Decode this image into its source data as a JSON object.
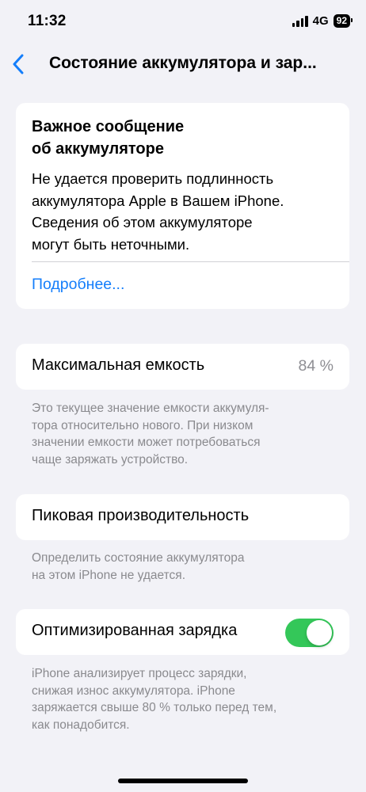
{
  "status_bar": {
    "time": "11:32",
    "network": "4G",
    "battery_level": "92",
    "icons": [
      "signal-icon",
      "battery-icon"
    ]
  },
  "nav": {
    "title": "Состояние аккумулятора и зар...",
    "back_icon": "chevron-left-icon"
  },
  "alert": {
    "title": "Важное сообщение\nоб аккумуляторе",
    "body": "Не удается проверить подлинность\nаккумулятора Apple в Вашем iPhone.\nСведения об этом аккумуляторе\nмогут быть неточными.",
    "link": "Подробнее..."
  },
  "max_capacity": {
    "label": "Максимальная емкость",
    "value": "84 %",
    "footnote": "Это текущее значение емкости аккумуля-\nтора относительно нового. При низком\nзначении емкости может потребоваться\nчаще заряжать устройство."
  },
  "peak_performance": {
    "label": "Пиковая производительность",
    "footnote": "Определить состояние аккумулятора\nна этом iPhone не удается."
  },
  "optimized_charging": {
    "label": "Оптимизированная зарядка",
    "enabled": true,
    "footnote": "iPhone анализирует процесс зарядки,\nснижая износ аккумулятора. iPhone\nзаряжается свыше 80 % только перед тем,\nкак понадобится."
  },
  "colors": {
    "accent": "#147EFB",
    "toggle_on": "#34C759",
    "background": "#F2F2F7",
    "secondary_text": "#8A8A8E"
  }
}
